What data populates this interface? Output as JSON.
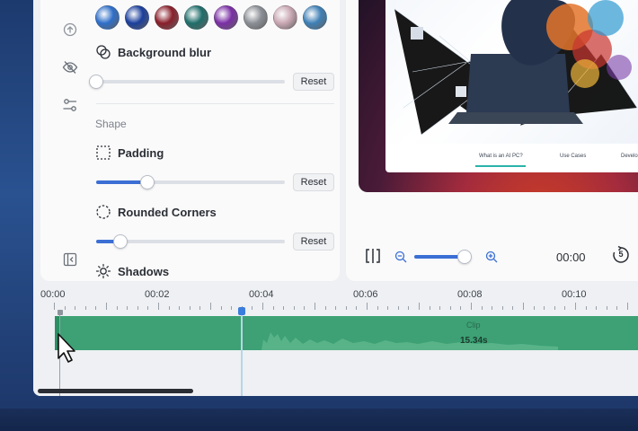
{
  "style_panel": {
    "background_blur": {
      "label": "Background blur",
      "value": 0,
      "reset_label": "Reset"
    },
    "shape_heading": "Shape",
    "padding": {
      "label": "Padding",
      "value": 0.27,
      "reset_label": "Reset"
    },
    "rounded_corners": {
      "label": "Rounded Corners",
      "value": 0.13,
      "reset_label": "Reset"
    },
    "shadows": {
      "label": "Shadows"
    },
    "background_swatches": [
      {
        "name": "blue-wave",
        "color": "#2f6fc9"
      },
      {
        "name": "blue-swirl",
        "color": "#1b3f9c"
      },
      {
        "name": "red-black",
        "color": "#8a1f2b"
      },
      {
        "name": "aurora-green",
        "color": "#1f6e6a"
      },
      {
        "name": "magenta-purple",
        "color": "#7b2fa6"
      },
      {
        "name": "grey-wave",
        "color": "#8b8f95"
      },
      {
        "name": "pink-grey",
        "color": "#c9a7b3"
      },
      {
        "name": "teal-blue",
        "color": "#3f80b6"
      }
    ]
  },
  "preview": {
    "nav_items": [
      "What is an AI PC?",
      "Use Cases",
      "Develo"
    ],
    "zoom_level": 0.88,
    "time": "00:00",
    "skip_seconds": "5"
  },
  "timeline": {
    "ruler_labels": [
      "00:00",
      "00:02",
      "00:04",
      "00:06",
      "00:08",
      "00:10"
    ],
    "clip": {
      "label": "Clip",
      "duration": "15.34s"
    }
  },
  "colors": {
    "accent": "#3b6fd4",
    "clip_green": "#3da175",
    "playhead_blue": "#3b7ddc"
  }
}
